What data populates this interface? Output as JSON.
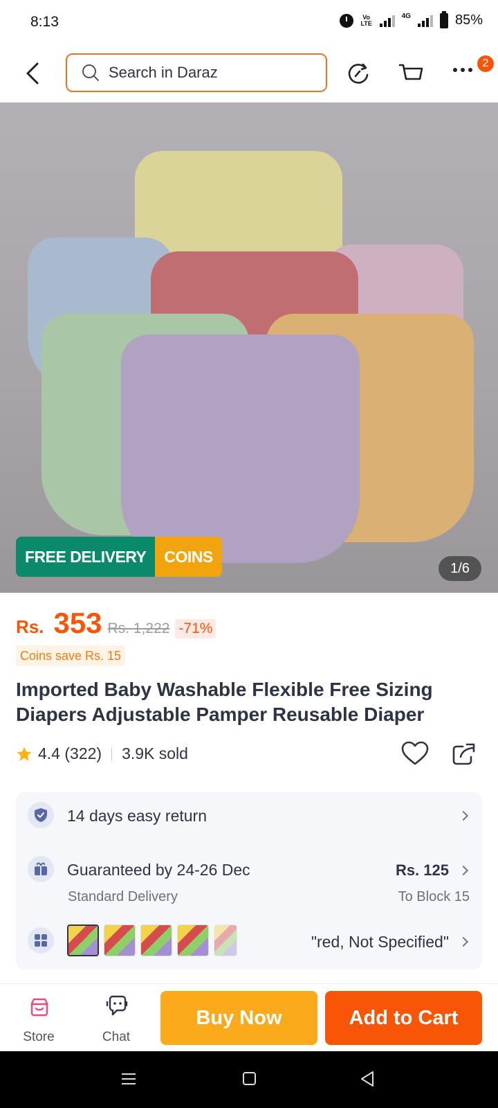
{
  "status_bar": {
    "time": "8:13",
    "volte": "Vo LTE",
    "net": "4G",
    "battery": "85%"
  },
  "header": {
    "search_placeholder": "Search in Daraz",
    "badge_count": "2"
  },
  "hero": {
    "tag_free_delivery": "FREE DELIVERY",
    "tag_coins": "COINS",
    "image_counter": "1/6"
  },
  "product": {
    "currency": "Rs.",
    "price": "353",
    "original_price": "Rs. 1,222",
    "discount": "-71%",
    "coins_save": "Coins save Rs. 15",
    "title": "Imported Baby Washable Flexible Free Sizing Diapers Adjustable Pamper Reusable Diaper",
    "rating": "4.4 (322)",
    "sold": "3.9K sold"
  },
  "info": {
    "return_label": "14 days easy return",
    "delivery_label": "Guaranteed by 24-26 Dec",
    "delivery_type": "Standard Delivery",
    "delivery_fee": "Rs. 125",
    "delivery_location": "To Block 15",
    "variant": "\"red, Not Specified\""
  },
  "bottom_bar": {
    "store_label": "Store",
    "chat_label": "Chat",
    "buy_now": "Buy Now",
    "add_to_cart": "Add to Cart"
  },
  "colors": {
    "brand_orange": "#f85606",
    "buy_now_yellow": "#fbaa1c",
    "free_delivery_green": "#0b8a6b",
    "coins_gold": "#f2a40d"
  },
  "icons": [
    "back-icon",
    "search-icon",
    "refresh-icon",
    "cart-icon",
    "more-icon",
    "star-icon",
    "heart-icon",
    "share-icon",
    "shield-icon",
    "gift-icon",
    "variants-icon",
    "chevron-right-icon",
    "store-icon",
    "chat-icon"
  ]
}
